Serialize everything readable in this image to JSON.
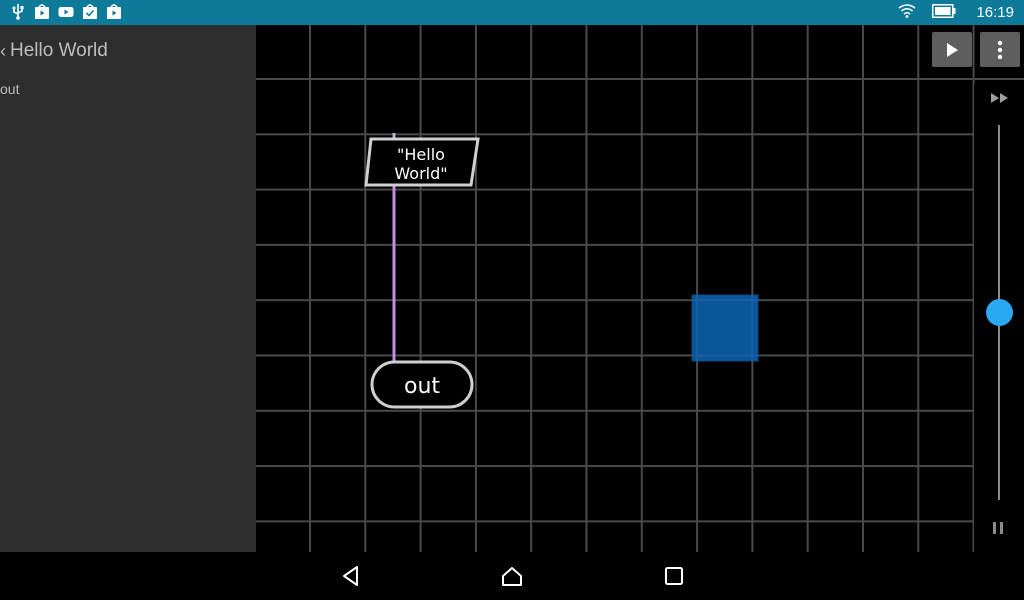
{
  "status_bar": {
    "time": "16:19",
    "left_icons": [
      "usb-icon",
      "play-store-icon",
      "youtube-icon",
      "checklist-icon",
      "play-store-icon"
    ],
    "right_icons": [
      "wifi-icon",
      "battery-icon"
    ]
  },
  "left_panel": {
    "title": "Hello World",
    "items": [
      "out"
    ]
  },
  "canvas": {
    "string_node_label": "\"Hello World\"",
    "output_node_label": "out",
    "selection_color": "#0d65b3",
    "wire_color": "#c28de8"
  },
  "toolbar": {
    "play_icon": "play-icon",
    "menu_icon": "more-vert-icon"
  },
  "speed_control": {
    "top_icon": "fast-forward-icon",
    "bottom_icon": "pause-icon",
    "level": 0.5
  },
  "nav_bar": {
    "icons": [
      "back-icon",
      "home-icon",
      "recents-icon"
    ]
  }
}
